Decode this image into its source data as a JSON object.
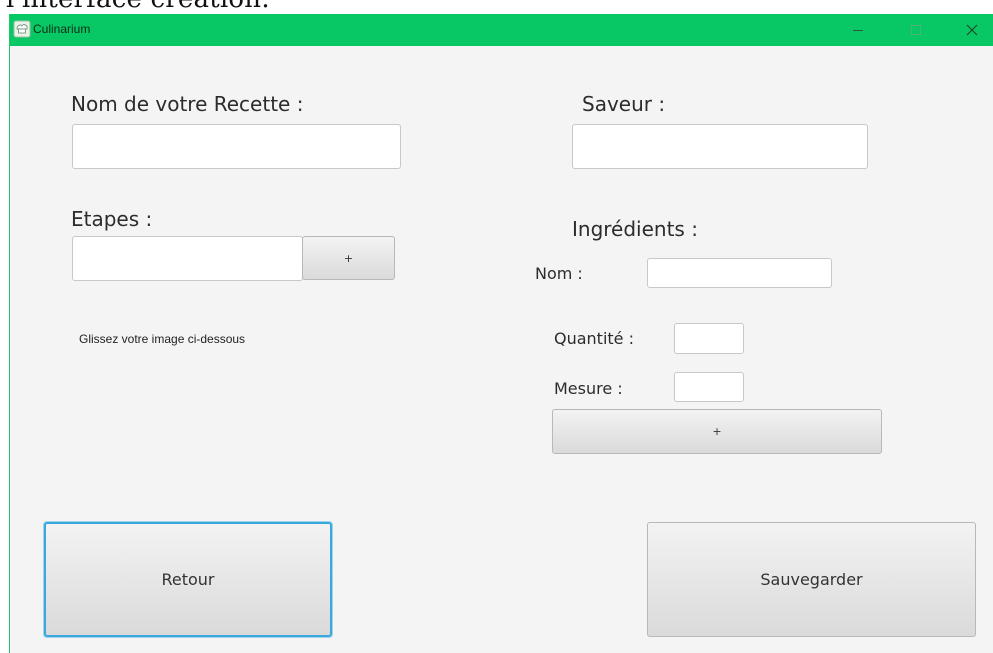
{
  "page_caption": "l'interface création:",
  "window": {
    "title": "Culinarium",
    "icon": "chef-hat-icon",
    "controls": {
      "minimize": "minimize-icon",
      "maximize": "maximize-icon",
      "close": "close-icon"
    },
    "titlebar_color": "#07c864"
  },
  "form": {
    "recipe_name_label": "Nom de votre Recette :",
    "recipe_name_value": "",
    "flavor_label": "Saveur :",
    "flavor_value": "",
    "steps_label": "Etapes :",
    "steps_value": "",
    "steps_add_label": "+",
    "image_hint": "Glissez votre image ci-dessous",
    "ingredients": {
      "heading": "Ingrédients :",
      "name_label": "Nom :",
      "name_value": "",
      "quantity_label": "Quantité :",
      "quantity_value": "",
      "measure_label": "Mesure :",
      "measure_value": "",
      "add_label": "+"
    }
  },
  "actions": {
    "back_label": "Retour",
    "save_label": "Sauvegarder"
  }
}
